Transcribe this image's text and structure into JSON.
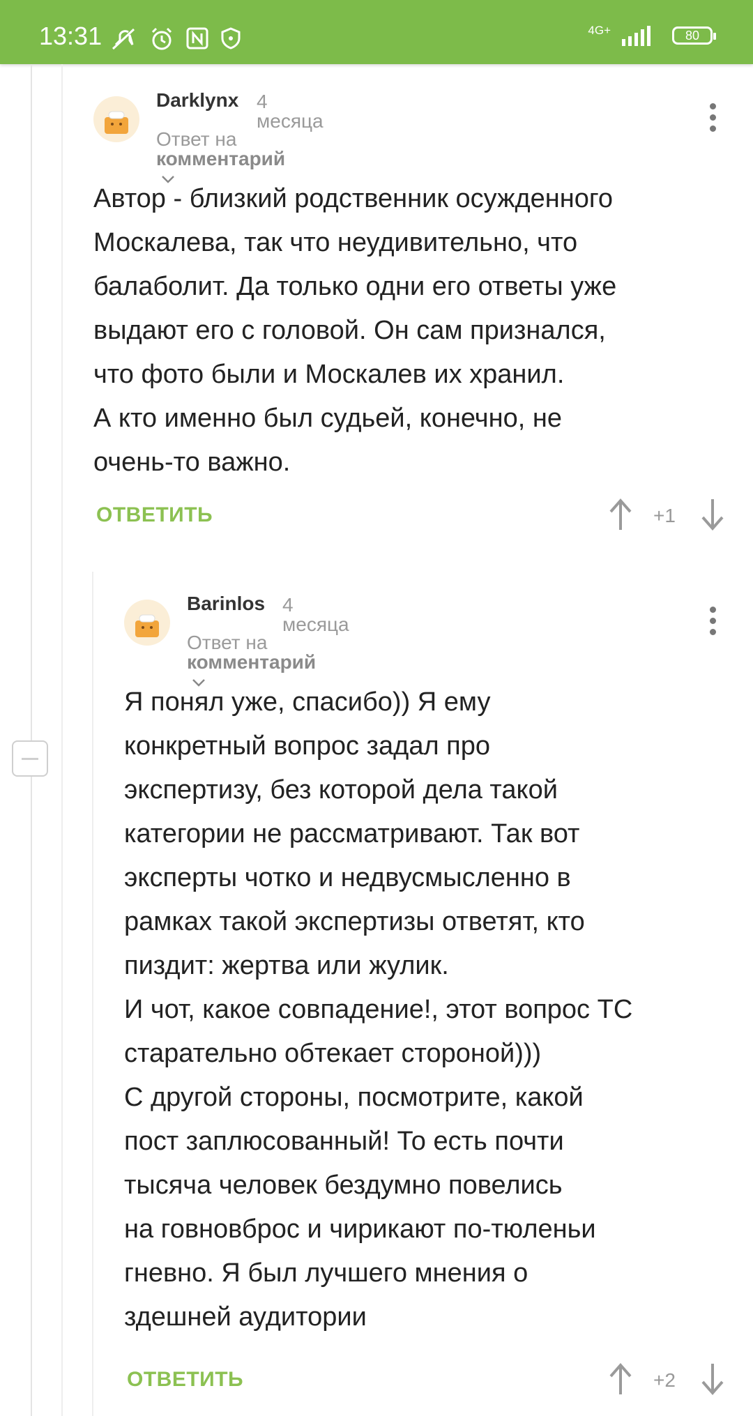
{
  "status_bar": {
    "time": "13:31",
    "network": "4G+",
    "battery": "80",
    "icons": [
      "muted-alarm-icon",
      "alarm-icon",
      "nfc-icon",
      "shield-icon",
      "signal-icon"
    ]
  },
  "comments": [
    {
      "author": "Darklynx",
      "time": "4 месяца",
      "reply_prefix": "Ответ на",
      "reply_target": "комментарий",
      "text": "Автор - близкий родственник осужденного\nМоскалева, так что неудивительно, что\nбалаболит. Да только одни его ответы уже\nвыдают его с головой. Он сам признался,\nчто фото были и Москалев их хранил.\nА кто именно был судьей, конечно, не\nочень-то важно.",
      "reply_label": "ОТВЕТИТЬ",
      "rating": "+1"
    },
    {
      "author": "Barinlos",
      "time": "4 месяца",
      "reply_prefix": "Ответ на",
      "reply_target": "комментарий",
      "text": "Я понял уже, спасибо)) Я ему\nконкретный вопрос задал про\nэкспертизу, без которой дела такой\nкатегории не рассматривают. Так вот\nэксперты чотко и недвусмысленно в\nрамках такой экспертизы ответят, кто\nпиздит: жертва или жулик.\nИ чот, какое совпадение!, этот вопрос ТС\nстарательно обтекает стороной)))\nС другой стороны, посмотрите, какой\nпост заплюсованный! То есть почти\nтысяча человек бездумно повелись\nна говновброс и чирикают по-тюленьи\nгневно. Я был лучшего мнения о\nздешней аудитории",
      "reply_label": "ОТВЕТИТЬ",
      "rating": "+2"
    }
  ]
}
